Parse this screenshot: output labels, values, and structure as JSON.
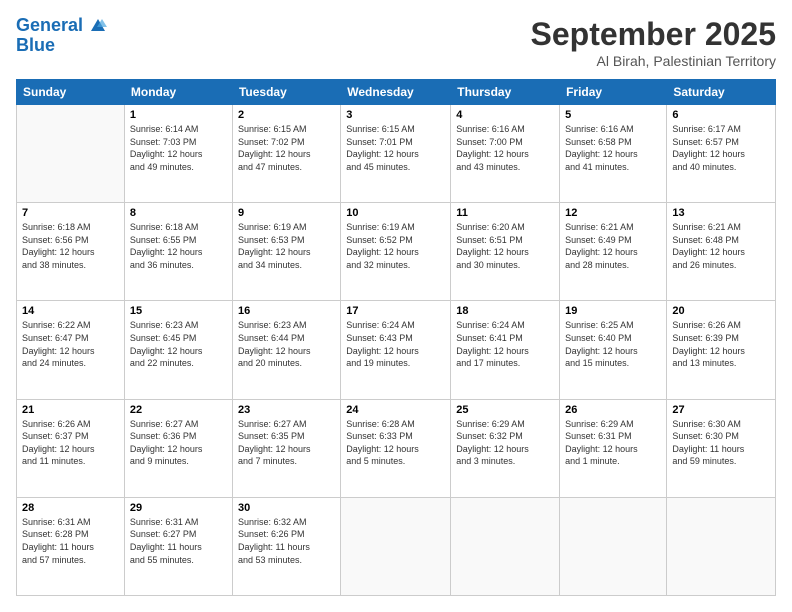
{
  "header": {
    "logo_line1": "General",
    "logo_line2": "Blue",
    "month": "September 2025",
    "location": "Al Birah, Palestinian Territory"
  },
  "weekdays": [
    "Sunday",
    "Monday",
    "Tuesday",
    "Wednesday",
    "Thursday",
    "Friday",
    "Saturday"
  ],
  "weeks": [
    [
      {
        "day": "",
        "info": ""
      },
      {
        "day": "1",
        "info": "Sunrise: 6:14 AM\nSunset: 7:03 PM\nDaylight: 12 hours\nand 49 minutes."
      },
      {
        "day": "2",
        "info": "Sunrise: 6:15 AM\nSunset: 7:02 PM\nDaylight: 12 hours\nand 47 minutes."
      },
      {
        "day": "3",
        "info": "Sunrise: 6:15 AM\nSunset: 7:01 PM\nDaylight: 12 hours\nand 45 minutes."
      },
      {
        "day": "4",
        "info": "Sunrise: 6:16 AM\nSunset: 7:00 PM\nDaylight: 12 hours\nand 43 minutes."
      },
      {
        "day": "5",
        "info": "Sunrise: 6:16 AM\nSunset: 6:58 PM\nDaylight: 12 hours\nand 41 minutes."
      },
      {
        "day": "6",
        "info": "Sunrise: 6:17 AM\nSunset: 6:57 PM\nDaylight: 12 hours\nand 40 minutes."
      }
    ],
    [
      {
        "day": "7",
        "info": "Sunrise: 6:18 AM\nSunset: 6:56 PM\nDaylight: 12 hours\nand 38 minutes."
      },
      {
        "day": "8",
        "info": "Sunrise: 6:18 AM\nSunset: 6:55 PM\nDaylight: 12 hours\nand 36 minutes."
      },
      {
        "day": "9",
        "info": "Sunrise: 6:19 AM\nSunset: 6:53 PM\nDaylight: 12 hours\nand 34 minutes."
      },
      {
        "day": "10",
        "info": "Sunrise: 6:19 AM\nSunset: 6:52 PM\nDaylight: 12 hours\nand 32 minutes."
      },
      {
        "day": "11",
        "info": "Sunrise: 6:20 AM\nSunset: 6:51 PM\nDaylight: 12 hours\nand 30 minutes."
      },
      {
        "day": "12",
        "info": "Sunrise: 6:21 AM\nSunset: 6:49 PM\nDaylight: 12 hours\nand 28 minutes."
      },
      {
        "day": "13",
        "info": "Sunrise: 6:21 AM\nSunset: 6:48 PM\nDaylight: 12 hours\nand 26 minutes."
      }
    ],
    [
      {
        "day": "14",
        "info": "Sunrise: 6:22 AM\nSunset: 6:47 PM\nDaylight: 12 hours\nand 24 minutes."
      },
      {
        "day": "15",
        "info": "Sunrise: 6:23 AM\nSunset: 6:45 PM\nDaylight: 12 hours\nand 22 minutes."
      },
      {
        "day": "16",
        "info": "Sunrise: 6:23 AM\nSunset: 6:44 PM\nDaylight: 12 hours\nand 20 minutes."
      },
      {
        "day": "17",
        "info": "Sunrise: 6:24 AM\nSunset: 6:43 PM\nDaylight: 12 hours\nand 19 minutes."
      },
      {
        "day": "18",
        "info": "Sunrise: 6:24 AM\nSunset: 6:41 PM\nDaylight: 12 hours\nand 17 minutes."
      },
      {
        "day": "19",
        "info": "Sunrise: 6:25 AM\nSunset: 6:40 PM\nDaylight: 12 hours\nand 15 minutes."
      },
      {
        "day": "20",
        "info": "Sunrise: 6:26 AM\nSunset: 6:39 PM\nDaylight: 12 hours\nand 13 minutes."
      }
    ],
    [
      {
        "day": "21",
        "info": "Sunrise: 6:26 AM\nSunset: 6:37 PM\nDaylight: 12 hours\nand 11 minutes."
      },
      {
        "day": "22",
        "info": "Sunrise: 6:27 AM\nSunset: 6:36 PM\nDaylight: 12 hours\nand 9 minutes."
      },
      {
        "day": "23",
        "info": "Sunrise: 6:27 AM\nSunset: 6:35 PM\nDaylight: 12 hours\nand 7 minutes."
      },
      {
        "day": "24",
        "info": "Sunrise: 6:28 AM\nSunset: 6:33 PM\nDaylight: 12 hours\nand 5 minutes."
      },
      {
        "day": "25",
        "info": "Sunrise: 6:29 AM\nSunset: 6:32 PM\nDaylight: 12 hours\nand 3 minutes."
      },
      {
        "day": "26",
        "info": "Sunrise: 6:29 AM\nSunset: 6:31 PM\nDaylight: 12 hours\nand 1 minute."
      },
      {
        "day": "27",
        "info": "Sunrise: 6:30 AM\nSunset: 6:30 PM\nDaylight: 11 hours\nand 59 minutes."
      }
    ],
    [
      {
        "day": "28",
        "info": "Sunrise: 6:31 AM\nSunset: 6:28 PM\nDaylight: 11 hours\nand 57 minutes."
      },
      {
        "day": "29",
        "info": "Sunrise: 6:31 AM\nSunset: 6:27 PM\nDaylight: 11 hours\nand 55 minutes."
      },
      {
        "day": "30",
        "info": "Sunrise: 6:32 AM\nSunset: 6:26 PM\nDaylight: 11 hours\nand 53 minutes."
      },
      {
        "day": "",
        "info": ""
      },
      {
        "day": "",
        "info": ""
      },
      {
        "day": "",
        "info": ""
      },
      {
        "day": "",
        "info": ""
      }
    ]
  ]
}
